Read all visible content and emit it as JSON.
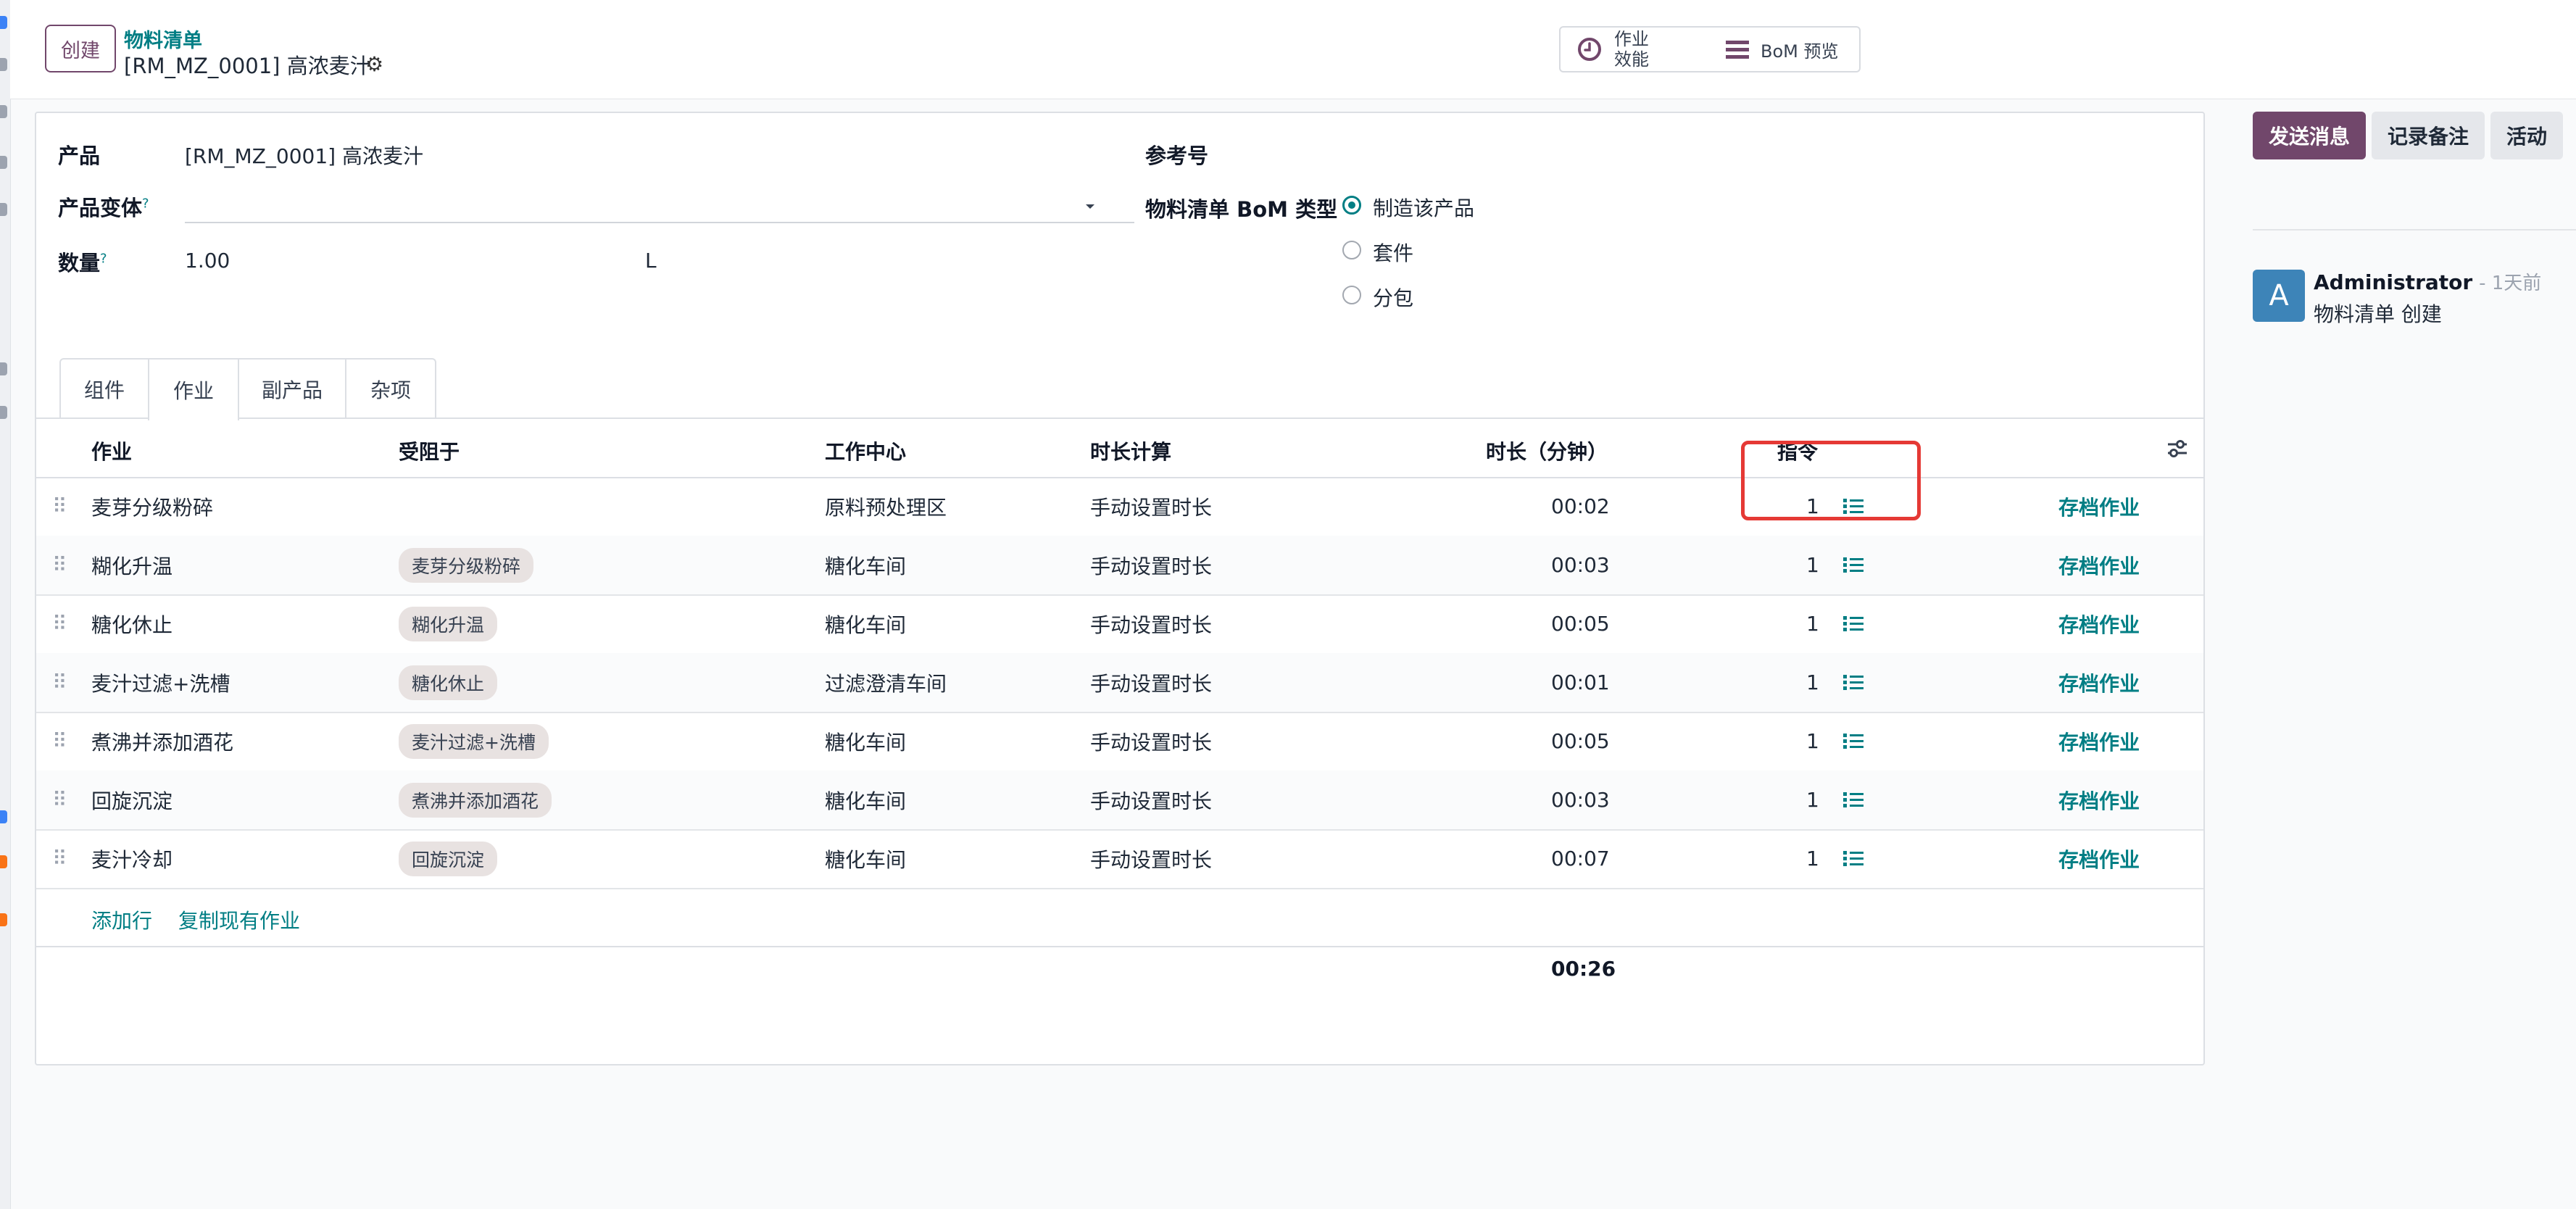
{
  "breadcrumb": {
    "create_label": "创建",
    "parent": "物料清单",
    "current": "[RM_MZ_0001] 高浓麦汁"
  },
  "smart_buttons": {
    "efficiency_line1": "作业",
    "efficiency_line2": "效能",
    "bom_preview": "BoM 预览"
  },
  "form": {
    "product_label": "产品",
    "product_value": "[RM_MZ_0001] 高浓麦汁",
    "variant_label": "产品变体",
    "variant_help": "?",
    "qty_label": "数量",
    "qty_help": "?",
    "qty_value": "1.00",
    "qty_uom": "L",
    "ref_label": "参考号",
    "bom_type_label": "物料清单 BoM 类型",
    "bom_type_options": [
      "制造该产品",
      "套件",
      "分包"
    ],
    "bom_type_selected": "制造该产品"
  },
  "tabs": [
    "组件",
    "作业",
    "副产品",
    "杂项"
  ],
  "active_tab": "作业",
  "table": {
    "headers": {
      "operation": "作业",
      "blocked_by": "受阻于",
      "work_center": "工作中心",
      "duration_computation": "时长计算",
      "duration": "时长（分钟）",
      "instructions": "指令"
    },
    "rows": [
      {
        "operation": "麦芽分级粉碎",
        "blocked_by": "",
        "work_center": "原料预处理区",
        "duration_computation": "手动设置时长",
        "duration": "00:02",
        "instructions": "1",
        "action": "存档作业"
      },
      {
        "operation": "糊化升温",
        "blocked_by": "麦芽分级粉碎",
        "work_center": "糖化车间",
        "duration_computation": "手动设置时长",
        "duration": "00:03",
        "instructions": "1",
        "action": "存档作业"
      },
      {
        "operation": "糖化休止",
        "blocked_by": "糊化升温",
        "work_center": "糖化车间",
        "duration_computation": "手动设置时长",
        "duration": "00:05",
        "instructions": "1",
        "action": "存档作业"
      },
      {
        "operation": "麦汁过滤+洗槽",
        "blocked_by": "糖化休止",
        "work_center": "过滤澄清车间",
        "duration_computation": "手动设置时长",
        "duration": "00:01",
        "instructions": "1",
        "action": "存档作业"
      },
      {
        "operation": "煮沸并添加酒花",
        "blocked_by": "麦汁过滤+洗槽",
        "work_center": "糖化车间",
        "duration_computation": "手动设置时长",
        "duration": "00:05",
        "instructions": "1",
        "action": "存档作业"
      },
      {
        "operation": "回旋沉淀",
        "blocked_by": "煮沸并添加酒花",
        "work_center": "糖化车间",
        "duration_computation": "手动设置时长",
        "duration": "00:03",
        "instructions": "1",
        "action": "存档作业"
      },
      {
        "operation": "麦汁冷却",
        "blocked_by": "回旋沉淀",
        "work_center": "糖化车间",
        "duration_computation": "手动设置时长",
        "duration": "00:07",
        "instructions": "1",
        "action": "存档作业"
      }
    ],
    "add_line": "添加行",
    "copy_existing": "复制现有作业",
    "total": "00:26"
  },
  "chatter": {
    "send_message": "发送消息",
    "log_note": "记录备注",
    "activity": "活动",
    "avatar_letter": "A",
    "author": "Administrator",
    "time": "- 1天前",
    "body": "物料清单 创建"
  },
  "colors": {
    "primary": "#71476b",
    "link": "#017e84",
    "highlight": "#e53935",
    "avatar": "#3d84b8"
  }
}
